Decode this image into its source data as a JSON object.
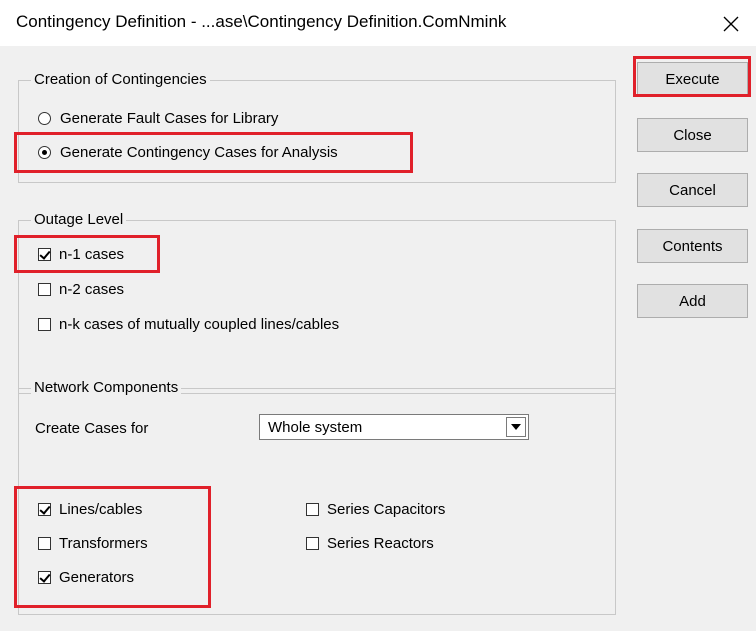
{
  "window": {
    "title": "Contingency Definition - ...ase\\Contingency Definition.ComNmink",
    "close_icon": "close-icon"
  },
  "creation": {
    "title": "Creation of Contingencies",
    "options": [
      {
        "label": "Generate Fault Cases for Library",
        "selected": false
      },
      {
        "label": "Generate Contingency Cases for Analysis",
        "selected": true
      }
    ]
  },
  "outage": {
    "title": "Outage Level",
    "options": [
      {
        "label": "n-1 cases",
        "checked": true
      },
      {
        "label": "n-2 cases",
        "checked": false
      },
      {
        "label": "n-k cases of mutually coupled lines/cables",
        "checked": false
      }
    ]
  },
  "network": {
    "title": "Network Components",
    "create_cases_label": "Create Cases for",
    "create_cases_value": "Whole system",
    "components_left": [
      {
        "label": "Lines/cables",
        "checked": true
      },
      {
        "label": "Transformers",
        "checked": false
      },
      {
        "label": "Generators",
        "checked": true
      }
    ],
    "components_right": [
      {
        "label": "Series Capacitors",
        "checked": false
      },
      {
        "label": "Series Reactors",
        "checked": false
      }
    ]
  },
  "buttons": {
    "execute": "Execute",
    "close": "Close",
    "cancel": "Cancel",
    "contents": "Contents",
    "add": "Add"
  },
  "colors": {
    "highlight": "#e0202a",
    "dialog_background": "#f0f0f0"
  }
}
